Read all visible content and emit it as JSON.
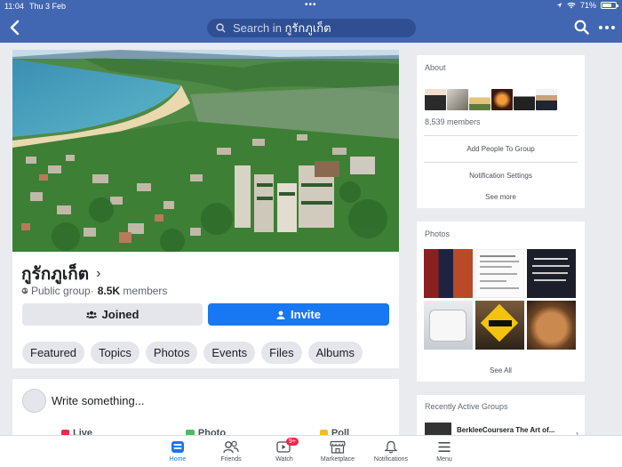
{
  "status_bar": {
    "time": "11:04",
    "date": "Thu 3 Feb",
    "battery": "71%",
    "battery_level": 0.71
  },
  "nav": {
    "search_prefix": "Search in",
    "search_query": "กูรักภูเก็ต"
  },
  "group": {
    "name": "กูรักภูเก็ต",
    "privacy": "Public group",
    "separator": "·",
    "members_count": "8.5K",
    "members_word": "members",
    "joined_label": "Joined",
    "invite_label": "Invite",
    "tabs": [
      "Featured",
      "Topics",
      "Photos",
      "Events",
      "Files",
      "Albums"
    ]
  },
  "composer": {
    "placeholder": "Write something...",
    "actions": [
      "Live",
      "Photo",
      "Poll"
    ]
  },
  "about": {
    "title": "About",
    "members": "8,539 members",
    "add_people": "Add People To Group",
    "notification_settings": "Notification Settings",
    "see_more": "See more"
  },
  "photos": {
    "title": "Photos",
    "see_all": "See All"
  },
  "recent": {
    "title": "Recently Active Groups",
    "group_name": "BerkleeCoursera The Art of..."
  },
  "tabbar": {
    "home": "Home",
    "friends": "Friends",
    "watch": "Watch",
    "watch_badge": "9+",
    "marketplace": "Marketplace",
    "notifications": "Notifications",
    "menu": "Menu"
  },
  "colors": {
    "brand": "#4267b2",
    "accent": "#1877f2",
    "badge": "#f02849"
  }
}
